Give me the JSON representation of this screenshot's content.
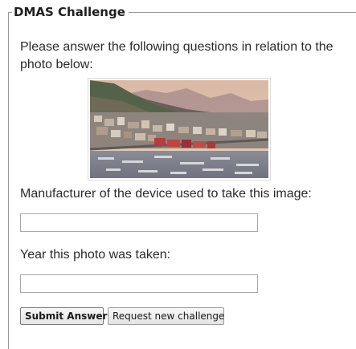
{
  "challenge": {
    "legend": "DMAS Challenge",
    "intro": "Please answer the following questions in relation to the photo below:",
    "photo_alt": "Coastal city with harbour and mountains",
    "questions": [
      {
        "label": "Manufacturer of the device used to take this image:",
        "value": ""
      },
      {
        "label": "Year this photo was taken:",
        "value": ""
      }
    ],
    "buttons": {
      "submit": "Submit Answer",
      "request": "Request new challenge"
    }
  }
}
